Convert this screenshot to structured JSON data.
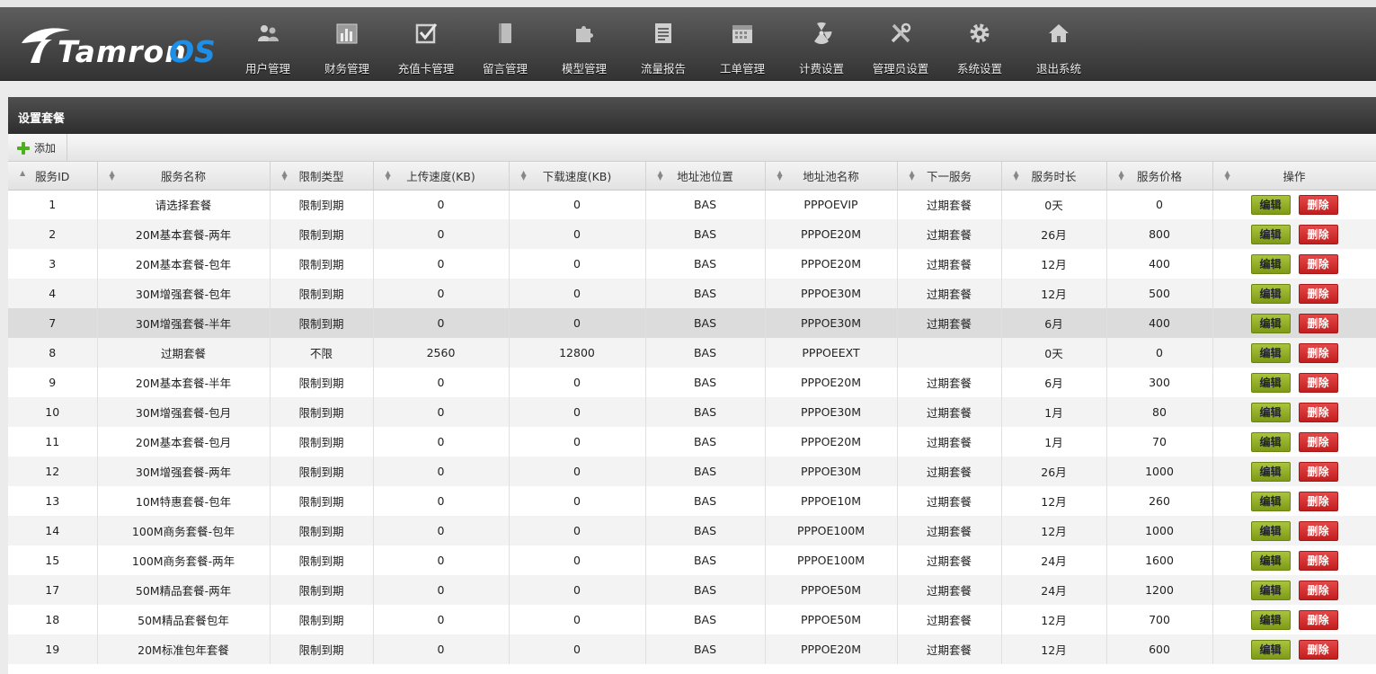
{
  "app": {
    "logo_text_white": "Tamron",
    "logo_text_blue": "OS",
    "colors": {
      "accent": "#1e8fe8",
      "edit": "#8fac23",
      "delete": "#d62c2c"
    }
  },
  "nav": [
    {
      "label": "用户管理",
      "icon": "users-icon"
    },
    {
      "label": "财务管理",
      "icon": "bar-chart-icon"
    },
    {
      "label": "充值卡管理",
      "icon": "checkbox-icon"
    },
    {
      "label": "留言管理",
      "icon": "book-icon"
    },
    {
      "label": "模型管理",
      "icon": "puzzle-icon"
    },
    {
      "label": "流量报告",
      "icon": "document-icon"
    },
    {
      "label": "工单管理",
      "icon": "calendar-icon"
    },
    {
      "label": "计费设置",
      "icon": "radiation-icon"
    },
    {
      "label": "管理员设置",
      "icon": "tools-icon"
    },
    {
      "label": "系统设置",
      "icon": "gear-icon"
    },
    {
      "label": "退出系统",
      "icon": "home-icon"
    }
  ],
  "panel": {
    "title": "设置套餐",
    "add_label": "添加"
  },
  "table": {
    "columns": [
      "服务ID",
      "服务名称",
      "限制类型",
      "上传速度(KB)",
      "下载速度(KB)",
      "地址池位置",
      "地址池名称",
      "下一服务",
      "服务时长",
      "服务价格",
      "操作"
    ],
    "edit_label": "编辑",
    "delete_label": "删除",
    "rows": [
      [
        "1",
        "请选择套餐",
        "限制到期",
        "0",
        "0",
        "BAS",
        "PPPOEVIP",
        "过期套餐",
        "0天",
        "0"
      ],
      [
        "2",
        "20M基本套餐-两年",
        "限制到期",
        "0",
        "0",
        "BAS",
        "PPPOE20M",
        "过期套餐",
        "26月",
        "800"
      ],
      [
        "3",
        "20M基本套餐-包年",
        "限制到期",
        "0",
        "0",
        "BAS",
        "PPPOE20M",
        "过期套餐",
        "12月",
        "400"
      ],
      [
        "4",
        "30M增强套餐-包年",
        "限制到期",
        "0",
        "0",
        "BAS",
        "PPPOE30M",
        "过期套餐",
        "12月",
        "500"
      ],
      [
        "7",
        "30M增强套餐-半年",
        "限制到期",
        "0",
        "0",
        "BAS",
        "PPPOE30M",
        "过期套餐",
        "6月",
        "400"
      ],
      [
        "8",
        "过期套餐",
        "不限",
        "2560",
        "12800",
        "BAS",
        "PPPOEEXT",
        "",
        "0天",
        "0"
      ],
      [
        "9",
        "20M基本套餐-半年",
        "限制到期",
        "0",
        "0",
        "BAS",
        "PPPOE20M",
        "过期套餐",
        "6月",
        "300"
      ],
      [
        "10",
        "30M增强套餐-包月",
        "限制到期",
        "0",
        "0",
        "BAS",
        "PPPOE30M",
        "过期套餐",
        "1月",
        "80"
      ],
      [
        "11",
        "20M基本套餐-包月",
        "限制到期",
        "0",
        "0",
        "BAS",
        "PPPOE20M",
        "过期套餐",
        "1月",
        "70"
      ],
      [
        "12",
        "30M增强套餐-两年",
        "限制到期",
        "0",
        "0",
        "BAS",
        "PPPOE30M",
        "过期套餐",
        "26月",
        "1000"
      ],
      [
        "13",
        "10M特惠套餐-包年",
        "限制到期",
        "0",
        "0",
        "BAS",
        "PPPOE10M",
        "过期套餐",
        "12月",
        "260"
      ],
      [
        "14",
        "100M商务套餐-包年",
        "限制到期",
        "0",
        "0",
        "BAS",
        "PPPOE100M",
        "过期套餐",
        "12月",
        "1000"
      ],
      [
        "15",
        "100M商务套餐-两年",
        "限制到期",
        "0",
        "0",
        "BAS",
        "PPPOE100M",
        "过期套餐",
        "24月",
        "1600"
      ],
      [
        "17",
        "50M精品套餐-两年",
        "限制到期",
        "0",
        "0",
        "BAS",
        "PPPOE50M",
        "过期套餐",
        "24月",
        "1200"
      ],
      [
        "18",
        "50M精品套餐包年",
        "限制到期",
        "0",
        "0",
        "BAS",
        "PPPOE50M",
        "过期套餐",
        "12月",
        "700"
      ],
      [
        "19",
        "20M标准包年套餐",
        "限制到期",
        "0",
        "0",
        "BAS",
        "PPPOE20M",
        "过期套餐",
        "12月",
        "600"
      ]
    ],
    "highlighted_row": 4
  }
}
